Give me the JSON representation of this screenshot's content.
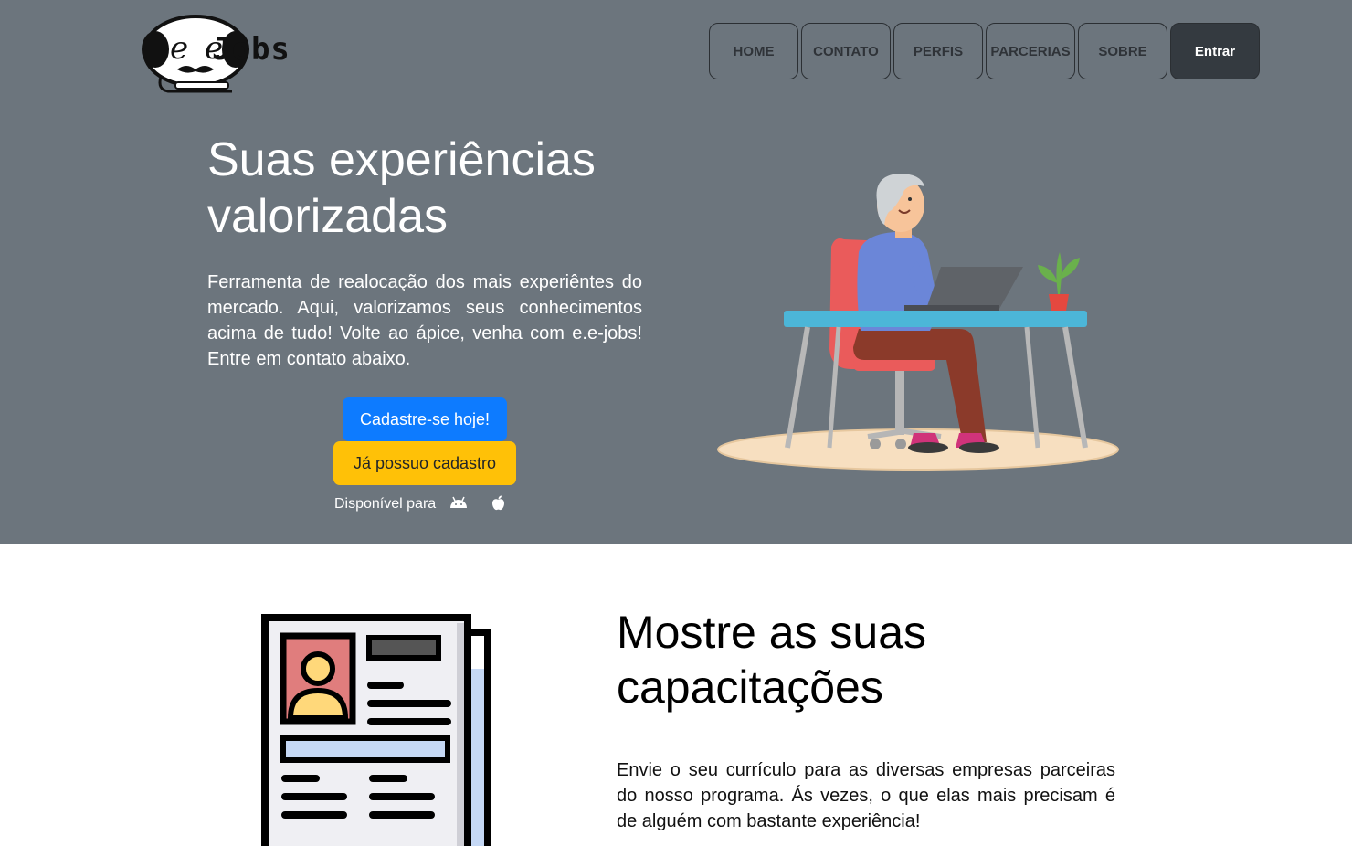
{
  "brand": {
    "name": "Jobs",
    "logo_letters": "e e"
  },
  "nav": {
    "items": [
      "HOME",
      "CONTATO",
      "PERFIS",
      "PARCERIAS",
      "SOBRE"
    ],
    "login_label": "Entrar"
  },
  "hero": {
    "title": "Suas experiências valorizadas",
    "text": "Ferramenta de realocação dos mais experiêntes do mercado. Aqui, valorizamos seus conhecimentos acima de tudo! Volte ao ápice, venha com e.e-jobs! Entre em contato abaixo.",
    "signup_label": "Cadastre-se hoje!",
    "login_label": "Já possuo cadastro",
    "available_label": "Disponível para",
    "platform_icons": [
      "android-icon",
      "apple-icon"
    ]
  },
  "section": {
    "title": "Mostre as suas capacitações",
    "text": "Envie o seu currículo para as diversas empresas parceiras do nosso programa. Ás vezes, o que elas mais precisam é de alguém com bastante experiência!"
  },
  "colors": {
    "hero_bg": "#6c757d",
    "primary": "#0d7bff",
    "warning": "#ffc107",
    "dark": "#343a40"
  }
}
